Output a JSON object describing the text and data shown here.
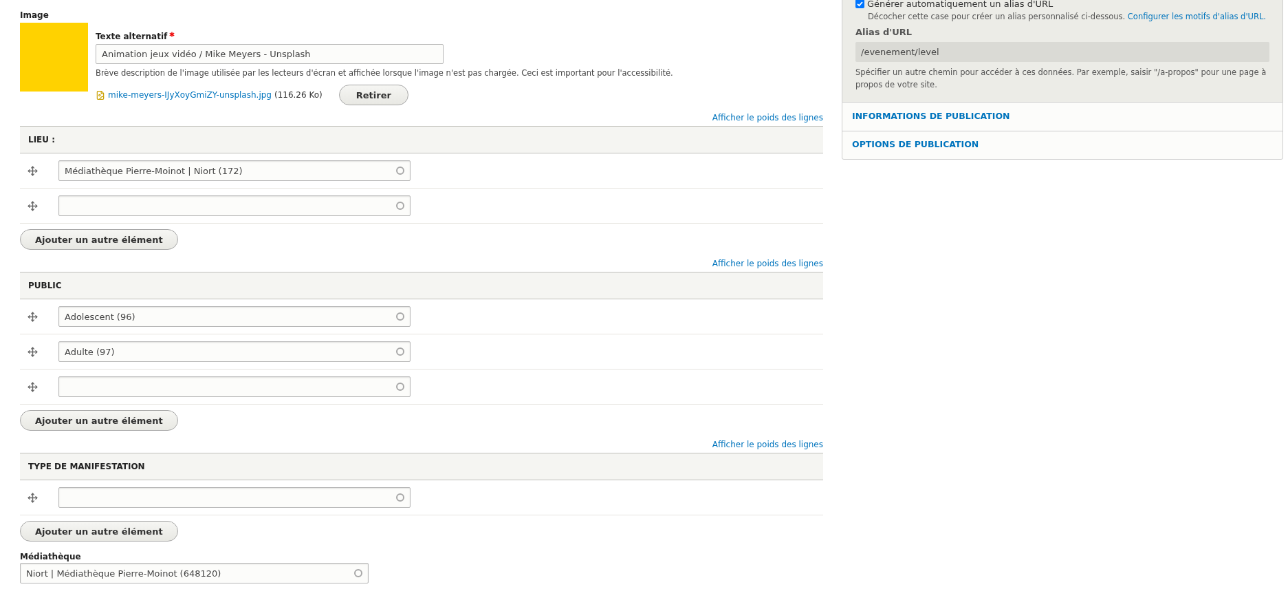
{
  "image_field": {
    "label": "Image",
    "alt_label": "Texte alternatif",
    "required": true,
    "alt_value": "Animation jeux vidéo / Mike Meyers - Unsplash",
    "alt_description": "Brève description de l'image utilisée par les lecteurs d'écran et affichée lorsque l'image n'est pas chargée. Ceci est important pour l'accessibilité.",
    "file_name": "mike-meyers-IJyXoyGmiZY-unsplash.jpg",
    "file_size": "(116.26 Ko)",
    "remove_button": "Retirer"
  },
  "field_tables": [
    {
      "weights_link": "Afficher le poids des lignes",
      "header": "LIEU :",
      "rows": [
        {
          "value": "Médiathèque Pierre-Moinot | Niort (172)"
        },
        {}
      ],
      "add_button": "Ajouter un autre élément"
    },
    {
      "weights_link": "Afficher le poids des lignes",
      "header": "PUBLIC",
      "rows": [
        {
          "value": "Adolescent (96)"
        },
        {
          "value": "Adulte (97)"
        },
        {}
      ],
      "add_button": "Ajouter un autre élément"
    },
    {
      "weights_link": "Afficher le poids des lignes",
      "header": "TYPE DE MANIFESTATION",
      "rows": [
        {}
      ],
      "add_button": "Ajouter un autre élément"
    }
  ],
  "mediatheque": {
    "label": "Médiathèque",
    "value": "Niort | Médiathèque Pierre-Moinot (648120)"
  },
  "sidebar": {
    "auto_alias": {
      "label": "Générer automatiquement un alias d'URL",
      "checked": true,
      "description": "Décocher cette case pour créer un alias personnalisé ci-dessous.",
      "link": "Configurer les motifs d'alias d'URL."
    },
    "alias": {
      "label": "Alias d'URL",
      "value": "/evenement/level",
      "disabled": true,
      "description": "Spécifier un autre chemin pour accéder à ces données. Par exemple, saisir \"/a-propos\" pour une page à propos de votre site."
    },
    "sections": [
      {
        "title": "INFORMATIONS DE PUBLICATION",
        "expanded": false
      },
      {
        "title": "OPTIONS DE PUBLICATION",
        "expanded": false
      }
    ]
  }
}
